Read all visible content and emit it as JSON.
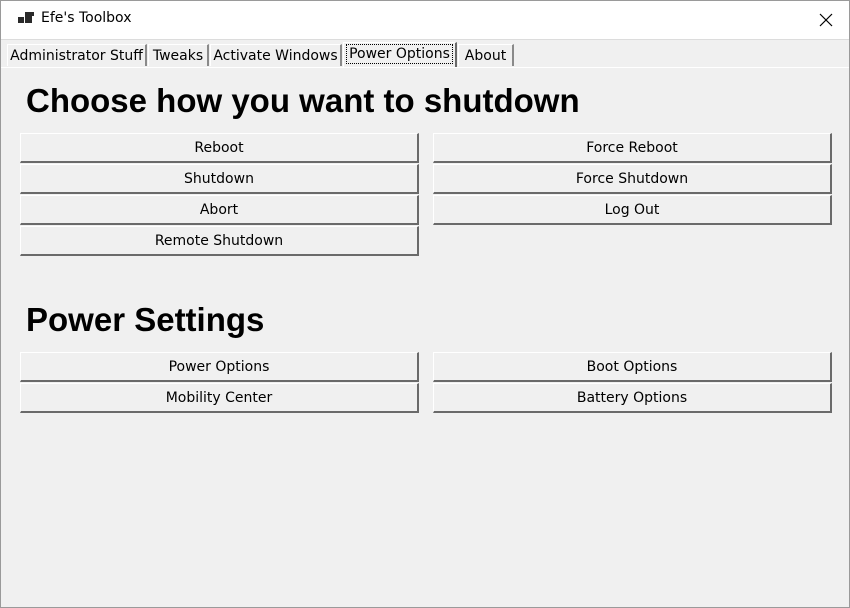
{
  "window": {
    "title": "Efe's Toolbox"
  },
  "tabs": [
    {
      "label": "Administrator Stuff"
    },
    {
      "label": "Tweaks"
    },
    {
      "label": "Activate Windows"
    },
    {
      "label": "Power Options"
    },
    {
      "label": "About"
    }
  ],
  "shutdown_section": {
    "heading": "Choose how you want to shutdown",
    "buttons": {
      "reboot": "Reboot",
      "force_reboot": "Force Reboot",
      "shutdown": "Shutdown",
      "force_shutdown": "Force Shutdown",
      "abort": "Abort",
      "log_out": "Log Out",
      "remote_shutdown": "Remote Shutdown"
    }
  },
  "power_settings_section": {
    "heading": "Power Settings",
    "buttons": {
      "power_options": "Power Options",
      "boot_options": "Boot Options",
      "mobility_center": "Mobility Center",
      "battery_options": "Battery Options"
    }
  }
}
